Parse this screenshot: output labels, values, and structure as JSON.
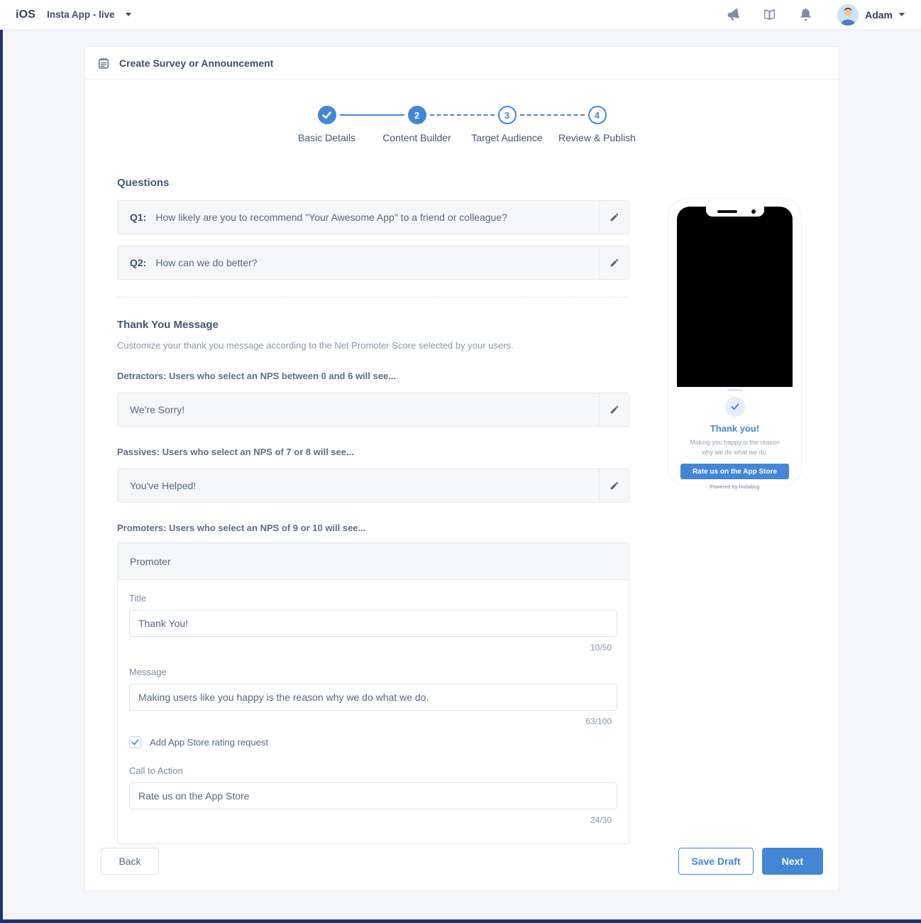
{
  "topbar": {
    "platform": "iOS",
    "app_selector": "Insta App - live",
    "user_name": "Adam"
  },
  "card": {
    "title": "Create Survey or Announcement"
  },
  "stepper": {
    "steps": [
      {
        "label": "Basic Details",
        "state": "done"
      },
      {
        "label": "Content Builder",
        "state": "active",
        "number": "2"
      },
      {
        "label": "Target Audience",
        "state": "todo",
        "number": "3"
      },
      {
        "label": "Review & Publish",
        "state": "todo",
        "number": "4"
      }
    ]
  },
  "questions": {
    "heading": "Questions",
    "items": [
      {
        "prefix": "Q1:",
        "text": "How likely are you to recommend \"Your Awesome App\" to a friend or colleague?"
      },
      {
        "prefix": "Q2:",
        "text": "How can we do better?"
      }
    ]
  },
  "thank_you": {
    "heading": "Thank You Message",
    "description": "Customize your thank you message according to the Net Promoter Score selected by your users.",
    "detractors_label": "Detractors: Users who select an NPS between 0 and 6 will see...",
    "detractors_value": "We're Sorry!",
    "passives_label": "Passives: Users who select an NPS of 7 or 8 will see...",
    "passives_value": "You've Helped!",
    "promoters_label": "Promoters: Users who select an NPS of 9 or 10 will see...",
    "promoter_panel": {
      "header": "Promoter",
      "title_label": "Title",
      "title_value": "Thank You!",
      "title_counter": "10/50",
      "message_label": "Message",
      "message_value": "Making users like you happy is the reason why we do what we do.",
      "message_counter": "63/100",
      "checkbox_label": "Add App Store rating request",
      "checkbox_checked": true,
      "cta_label": "Call to Action",
      "cta_value": "Rate us on the App Store",
      "cta_counter": "24/30"
    }
  },
  "preview": {
    "title": "Thank you!",
    "message": "Making you happy is the reason why we do what we do.",
    "button": "Rate us on the App Store",
    "powered_by": "Powered by Instabug"
  },
  "footer": {
    "back": "Back",
    "save_draft": "Save Draft",
    "next": "Next"
  },
  "colors": {
    "accent_blue": "#4386d6",
    "navy_strip": "#1d3174",
    "page_background": "#f4f6f9"
  }
}
